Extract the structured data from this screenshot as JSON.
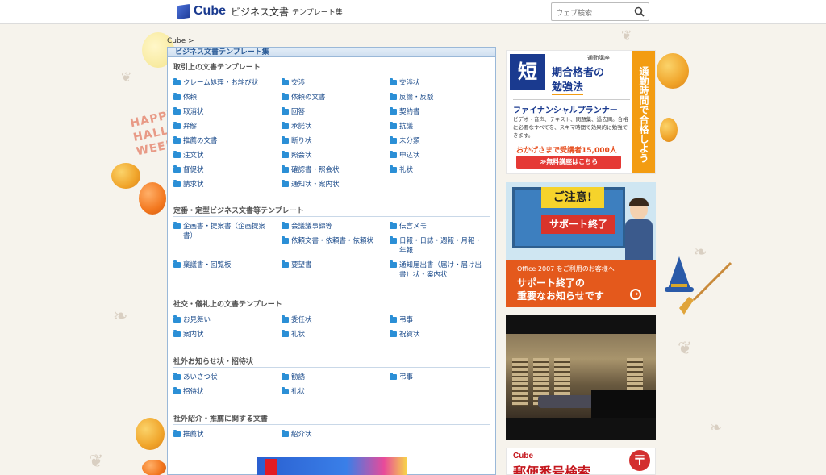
{
  "header": {
    "logo_text": "Cube",
    "logo_sub": "ビジネス文書",
    "logo_sub2": "テンプレート集",
    "search_placeholder": "ウェブ検索"
  },
  "breadcrumb": "Cube >",
  "main": {
    "title": "ビジネス文書テンプレート集",
    "sections": [
      {
        "heading": "取引上の文書テンプレート",
        "items": [
          "クレーム処理・お詫び状",
          "交渉",
          "交渉状",
          "依頼",
          "依頼の文書",
          "反論・反駁",
          "取消状",
          "回答",
          "契約書",
          "弁解",
          "承諾状",
          "抗議",
          "推薦の文書",
          "断り状",
          "未分類",
          "注文状",
          "照会状",
          "申込状",
          "督促状",
          "確認書・照会状",
          "礼状",
          "請求状",
          "通知状・案内状"
        ]
      },
      {
        "heading": "定番・定型ビジネス文書等テンプレート",
        "items": [
          "企画書・提案書（企画提案書）",
          "会議議事録等",
          "伝言メモ",
          "稟議書・回覧板",
          "依頼文書・依頼書・依頼状",
          "日報・日誌・週報・月報・年報",
          "要望書",
          "通知届出書（届け・届け出書）状・案内状"
        ]
      },
      {
        "heading": "社交・儀礼上の文書テンプレート",
        "items": [
          "お見舞い",
          "委任状",
          "弔事",
          "案内状",
          "礼状",
          "祝賀状"
        ]
      },
      {
        "heading": "社外お知らせ状・招待状",
        "items": [
          "あいさつ状",
          "勧誘",
          "弔事",
          "招待状",
          "礼状"
        ]
      },
      {
        "heading": "社外紹介・推薦に関する文書",
        "items": [
          "推薦状",
          "紹介状"
        ]
      }
    ]
  },
  "ads": {
    "ad1": {
      "badge": "短",
      "school": "通勤講座",
      "headline1": "期合格者の",
      "headline2": "勉強法",
      "course": "ファイナンシャルプランナー",
      "desc": "ビデオ・音声、テキスト、問題集、過去問。合格に必要なすべてを、スキマ時間で効果的に勉強できます。",
      "count": "おかげさまで受講者15,000人",
      "button": "≫無料講座はこちら",
      "vertical": "通勤時間で合格しよう"
    },
    "ad2": {
      "caution": "ご注意!",
      "support_end": "サポート終了",
      "line1": "Office 2007 をご利用のお客様へ",
      "line2": "サポート終了の",
      "line3": "重要なお知らせです",
      "arrow": "→"
    },
    "ad4": {
      "logo": "Cube",
      "title": "郵便番号検索",
      "mark": "〒"
    }
  },
  "decor": {
    "happy_text": "HAPPY HALLO WEEN"
  }
}
